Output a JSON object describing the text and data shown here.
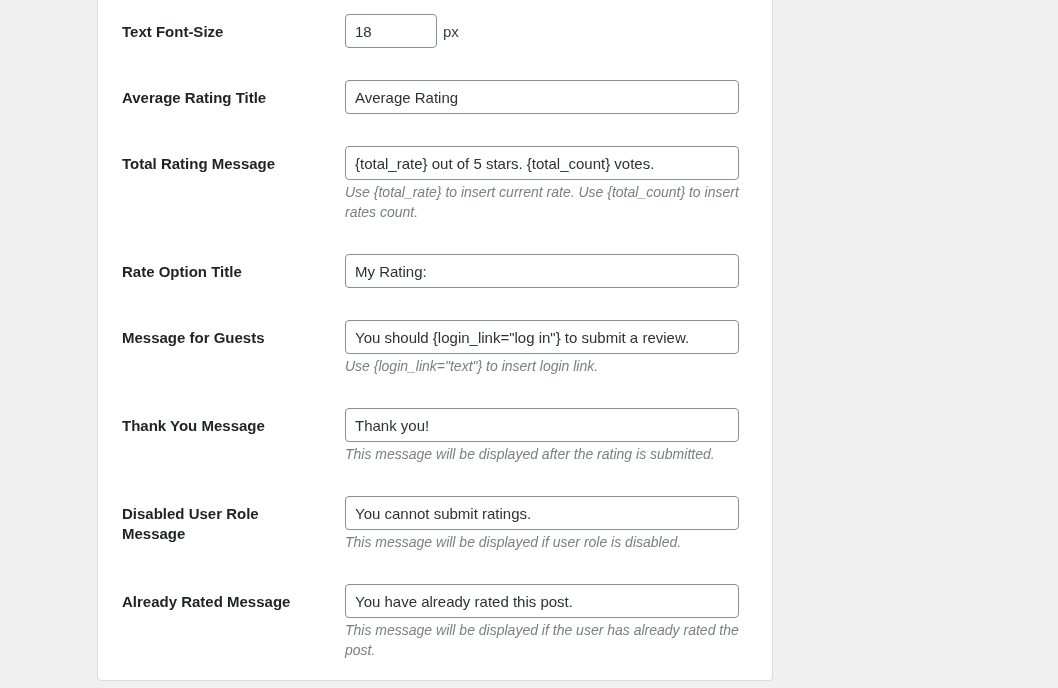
{
  "settings": [
    {
      "kind": "number",
      "label": "Text Font-Size",
      "value": "18",
      "unit": "px"
    },
    {
      "kind": "text",
      "label": "Average Rating Title",
      "value": "Average Rating"
    },
    {
      "kind": "text",
      "label": "Total Rating Message",
      "value": "{total_rate} out of 5 stars. {total_count} votes.",
      "description": "Use {total_rate} to insert current rate. Use {total_count} to insert rates count."
    },
    {
      "kind": "text",
      "label": "Rate Option Title",
      "value": "My Rating:"
    },
    {
      "kind": "text",
      "label": "Message for Guests",
      "value": "You should {login_link=\"log in\"} to submit a review.",
      "description": "Use {login_link=\"text\"} to insert login link."
    },
    {
      "kind": "text",
      "label": "Thank You Message",
      "value": "Thank you!",
      "description": "This message will be displayed after the rating is submitted."
    },
    {
      "kind": "text",
      "label": "Disabled User Role Message",
      "value": "You cannot submit ratings.",
      "description": "This message will be displayed if user role is disabled."
    },
    {
      "kind": "text",
      "label": "Already Rated Message",
      "value": "You have already rated this post.",
      "description": "This message will be displayed if the user has already rated the post."
    }
  ]
}
